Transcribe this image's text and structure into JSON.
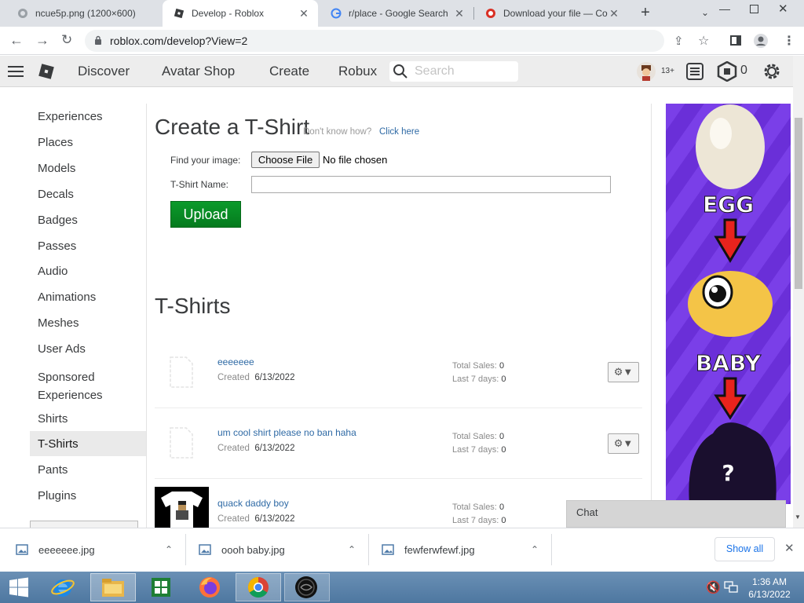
{
  "browser": {
    "tabs": [
      {
        "title": "ncue5p.png (1200×600)",
        "icon": "image-icon"
      },
      {
        "title": "Develop - Roblox",
        "icon": "roblox-icon"
      },
      {
        "title": "r/place - Google Search",
        "icon": "google-icon"
      },
      {
        "title": "Download your file — Co",
        "icon": "converter-icon"
      }
    ],
    "url": "roblox.com/develop?View=2"
  },
  "header": {
    "nav": [
      "Discover",
      "Avatar Shop",
      "Create",
      "Robux"
    ],
    "search_placeholder": "Search",
    "age_badge": "13+",
    "robux_count": "0"
  },
  "sidebar": {
    "items": [
      "Experiences",
      "Places",
      "Models",
      "Decals",
      "Badges",
      "Passes",
      "Audio",
      "Animations",
      "Meshes",
      "User Ads",
      "Sponsored Experiences",
      "Shirts",
      "T-Shirts",
      "Pants",
      "Plugins"
    ],
    "active": "T-Shirts"
  },
  "create": {
    "title": "Create a T-Shirt",
    "help_prefix": "Don't know how?",
    "help_link": "Click here",
    "find_image_label": "Find your image:",
    "choose_file_button": "Choose File",
    "no_file_text": "No file chosen",
    "name_label": "T-Shirt Name:",
    "name_value": "",
    "upload_button": "Upload"
  },
  "list": {
    "title": "T-Shirts",
    "created_label": "Created",
    "total_sales_label": "Total Sales:",
    "last7_label": "Last 7 days:",
    "items": [
      {
        "name": "eeeeeee",
        "created": "6/13/2022",
        "total_sales": "0",
        "last_7_days": "0"
      },
      {
        "name": "um cool shirt please no ban haha",
        "created": "6/13/2022",
        "total_sales": "0",
        "last_7_days": "0"
      },
      {
        "name": "quack daddy boy",
        "created": "6/13/2022",
        "total_sales": "0",
        "last_7_days": "0"
      }
    ]
  },
  "ad": {
    "words": [
      "EGG",
      "BABY",
      "?"
    ]
  },
  "chat": {
    "label": "Chat"
  },
  "downloads": {
    "files": [
      "eeeeeee.jpg",
      "oooh baby.jpg",
      "fewferwfewf.jpg"
    ],
    "show_all": "Show all"
  },
  "taskbar": {
    "time": "1:36 AM",
    "date": "6/13/2022"
  }
}
